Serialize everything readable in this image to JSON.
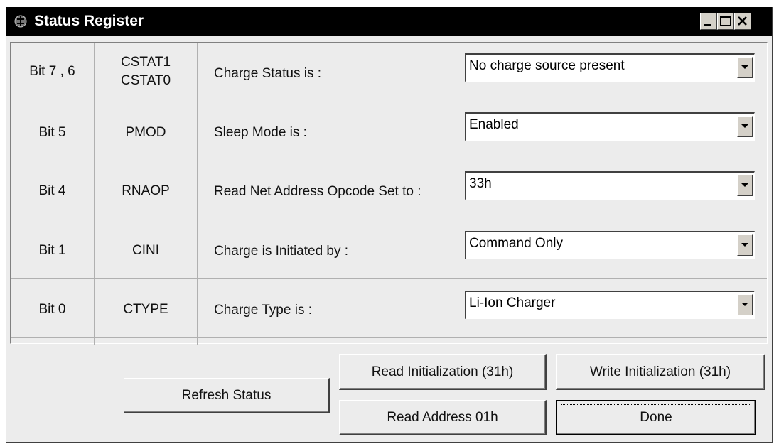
{
  "window": {
    "title": "Status Register",
    "controls": [
      "minimize",
      "maximize",
      "close"
    ]
  },
  "rows": [
    {
      "bit": "Bit 7 , 6",
      "name_line1": "CSTAT1",
      "name_line2": "CSTAT0",
      "label": "Charge Status is :",
      "value": "No charge source present"
    },
    {
      "bit": "Bit 5",
      "name_line1": "PMOD",
      "name_line2": "",
      "label": "Sleep Mode is :",
      "value": "Enabled"
    },
    {
      "bit": "Bit 4",
      "name_line1": "RNAOP",
      "name_line2": "",
      "label": "Read Net Address Opcode Set to :",
      "value": "33h"
    },
    {
      "bit": "Bit 1",
      "name_line1": "CINI",
      "name_line2": "",
      "label": "Charge is Initiated by :",
      "value": "Command Only"
    },
    {
      "bit": "Bit 0",
      "name_line1": "CTYPE",
      "name_line2": "",
      "label": "Charge Type is :",
      "value": "Li-Ion Charger"
    }
  ],
  "buttons": {
    "refresh": "Refresh Status",
    "read_init": "Read Initialization (31h)",
    "write_init": "Write Initialization (31h)",
    "read_address": "Read Address 01h",
    "done": "Done"
  }
}
